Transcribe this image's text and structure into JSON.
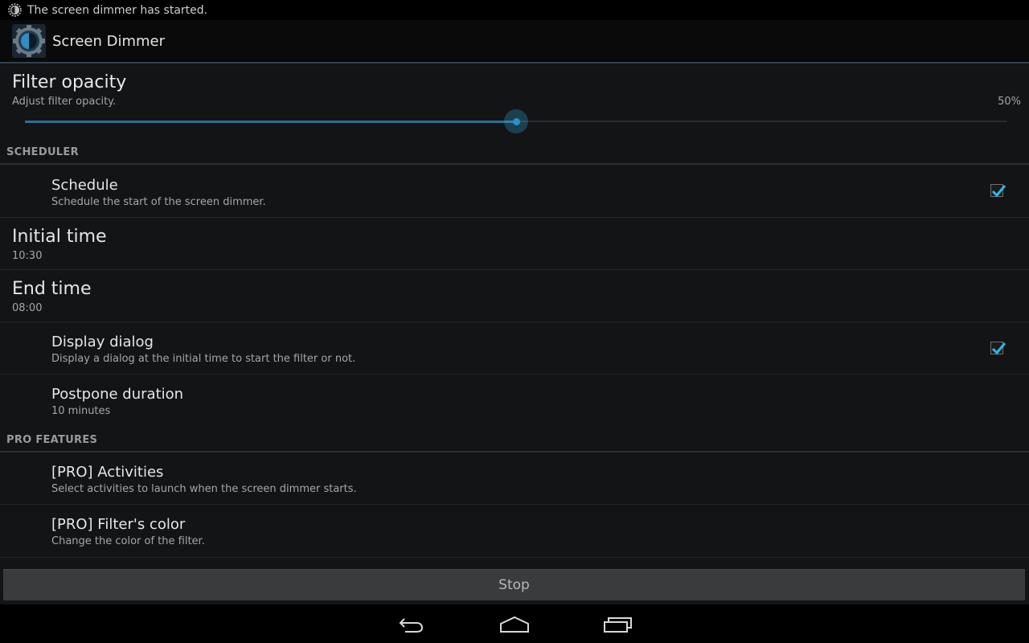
{
  "status_bar": {
    "icon": "screen-dimmer-status-icon",
    "notification": "The screen dimmer has started."
  },
  "action_bar": {
    "icon": "screen-dimmer-app-icon",
    "title": "Screen Dimmer"
  },
  "filter_opacity": {
    "title": "Filter opacity",
    "summary": "Adjust filter opacity.",
    "value_label": "50%",
    "value_fraction": 0.5
  },
  "scheduler": {
    "header": "SCHEDULER",
    "schedule": {
      "title": "Schedule",
      "summary": "Schedule the start of the screen dimmer.",
      "checked": true
    },
    "initial_time": {
      "title": "Initial time",
      "value": "10:30"
    },
    "end_time": {
      "title": "End time",
      "value": "08:00"
    },
    "display_dialog": {
      "title": "Display dialog",
      "summary": "Display a dialog at the initial time to start the filter or not.",
      "checked": true
    },
    "postpone_duration": {
      "title": "Postpone duration",
      "summary": "10 minutes"
    }
  },
  "pro_features": {
    "header": "PRO FEATURES",
    "activities": {
      "title": "[PRO] Activities",
      "summary": "Select activities to launch when the screen dimmer starts."
    },
    "filter_color": {
      "title": "[PRO] Filter's color",
      "summary": "Change the color of the filter."
    }
  },
  "stop_button": {
    "label": "Stop"
  },
  "nav_bar": {
    "back_icon": "back-icon",
    "home_icon": "home-icon",
    "recents_icon": "recents-icon"
  },
  "colors": {
    "accent": "#33b5e5",
    "slider_fill": "#2c6f96",
    "action_bar_divider": "#33414f"
  }
}
